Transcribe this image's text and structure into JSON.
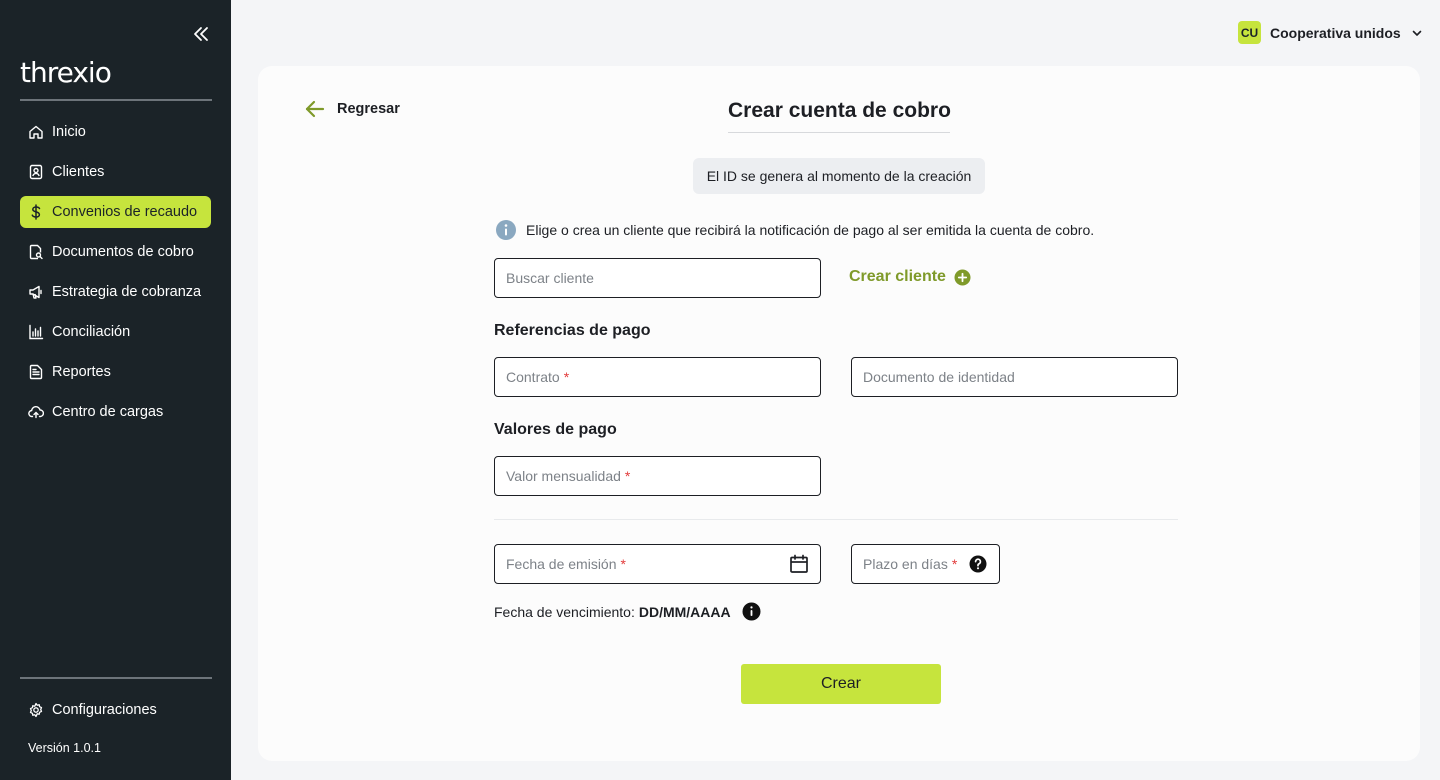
{
  "brand": {
    "logo_text": "threxio",
    "accent": "#c6e43d",
    "sidebar_bg": "#1b2328"
  },
  "sidebar": {
    "items": [
      {
        "label": "Inicio",
        "icon": "home-icon"
      },
      {
        "label": "Clientes",
        "icon": "contact-card-icon"
      },
      {
        "label": "Convenios de recaudo",
        "icon": "dollar-icon",
        "active": true
      },
      {
        "label": "Documentos de cobro",
        "icon": "document-search-icon"
      },
      {
        "label": "Estrategia de cobranza",
        "icon": "megaphone-icon"
      },
      {
        "label": "Conciliación",
        "icon": "bar-chart-icon"
      },
      {
        "label": "Reportes",
        "icon": "report-icon"
      },
      {
        "label": "Centro de cargas",
        "icon": "cloud-upload-icon"
      }
    ],
    "settings_label": "Configuraciones",
    "version": "Versión 1.0.1"
  },
  "header": {
    "org_initials": "CU",
    "org_name": "Cooperativa unidos"
  },
  "main": {
    "back_label": "Regresar",
    "title": "Crear cuenta de cobro",
    "id_notice": "El ID se genera al momento de la creación",
    "client_info": "Elige o crea un cliente que recibirá la notificación de pago al ser emitida la cuenta de cobro.",
    "search_client_placeholder": "Buscar cliente",
    "create_client_label": "Crear cliente",
    "payment_refs_title": "Referencias de pago",
    "contract_placeholder": "Contrato",
    "id_document_placeholder": "Documento de identidad",
    "payment_values_title": "Valores de pago",
    "monthly_value_placeholder": "Valor mensualidad",
    "issue_date_placeholder": "Fecha de emisión",
    "term_days_placeholder": "Plazo en días",
    "required_mark": "*",
    "due_date_label": "Fecha de vencimiento:",
    "due_date_value": "DD/MM/AAAA",
    "submit_label": "Crear"
  }
}
